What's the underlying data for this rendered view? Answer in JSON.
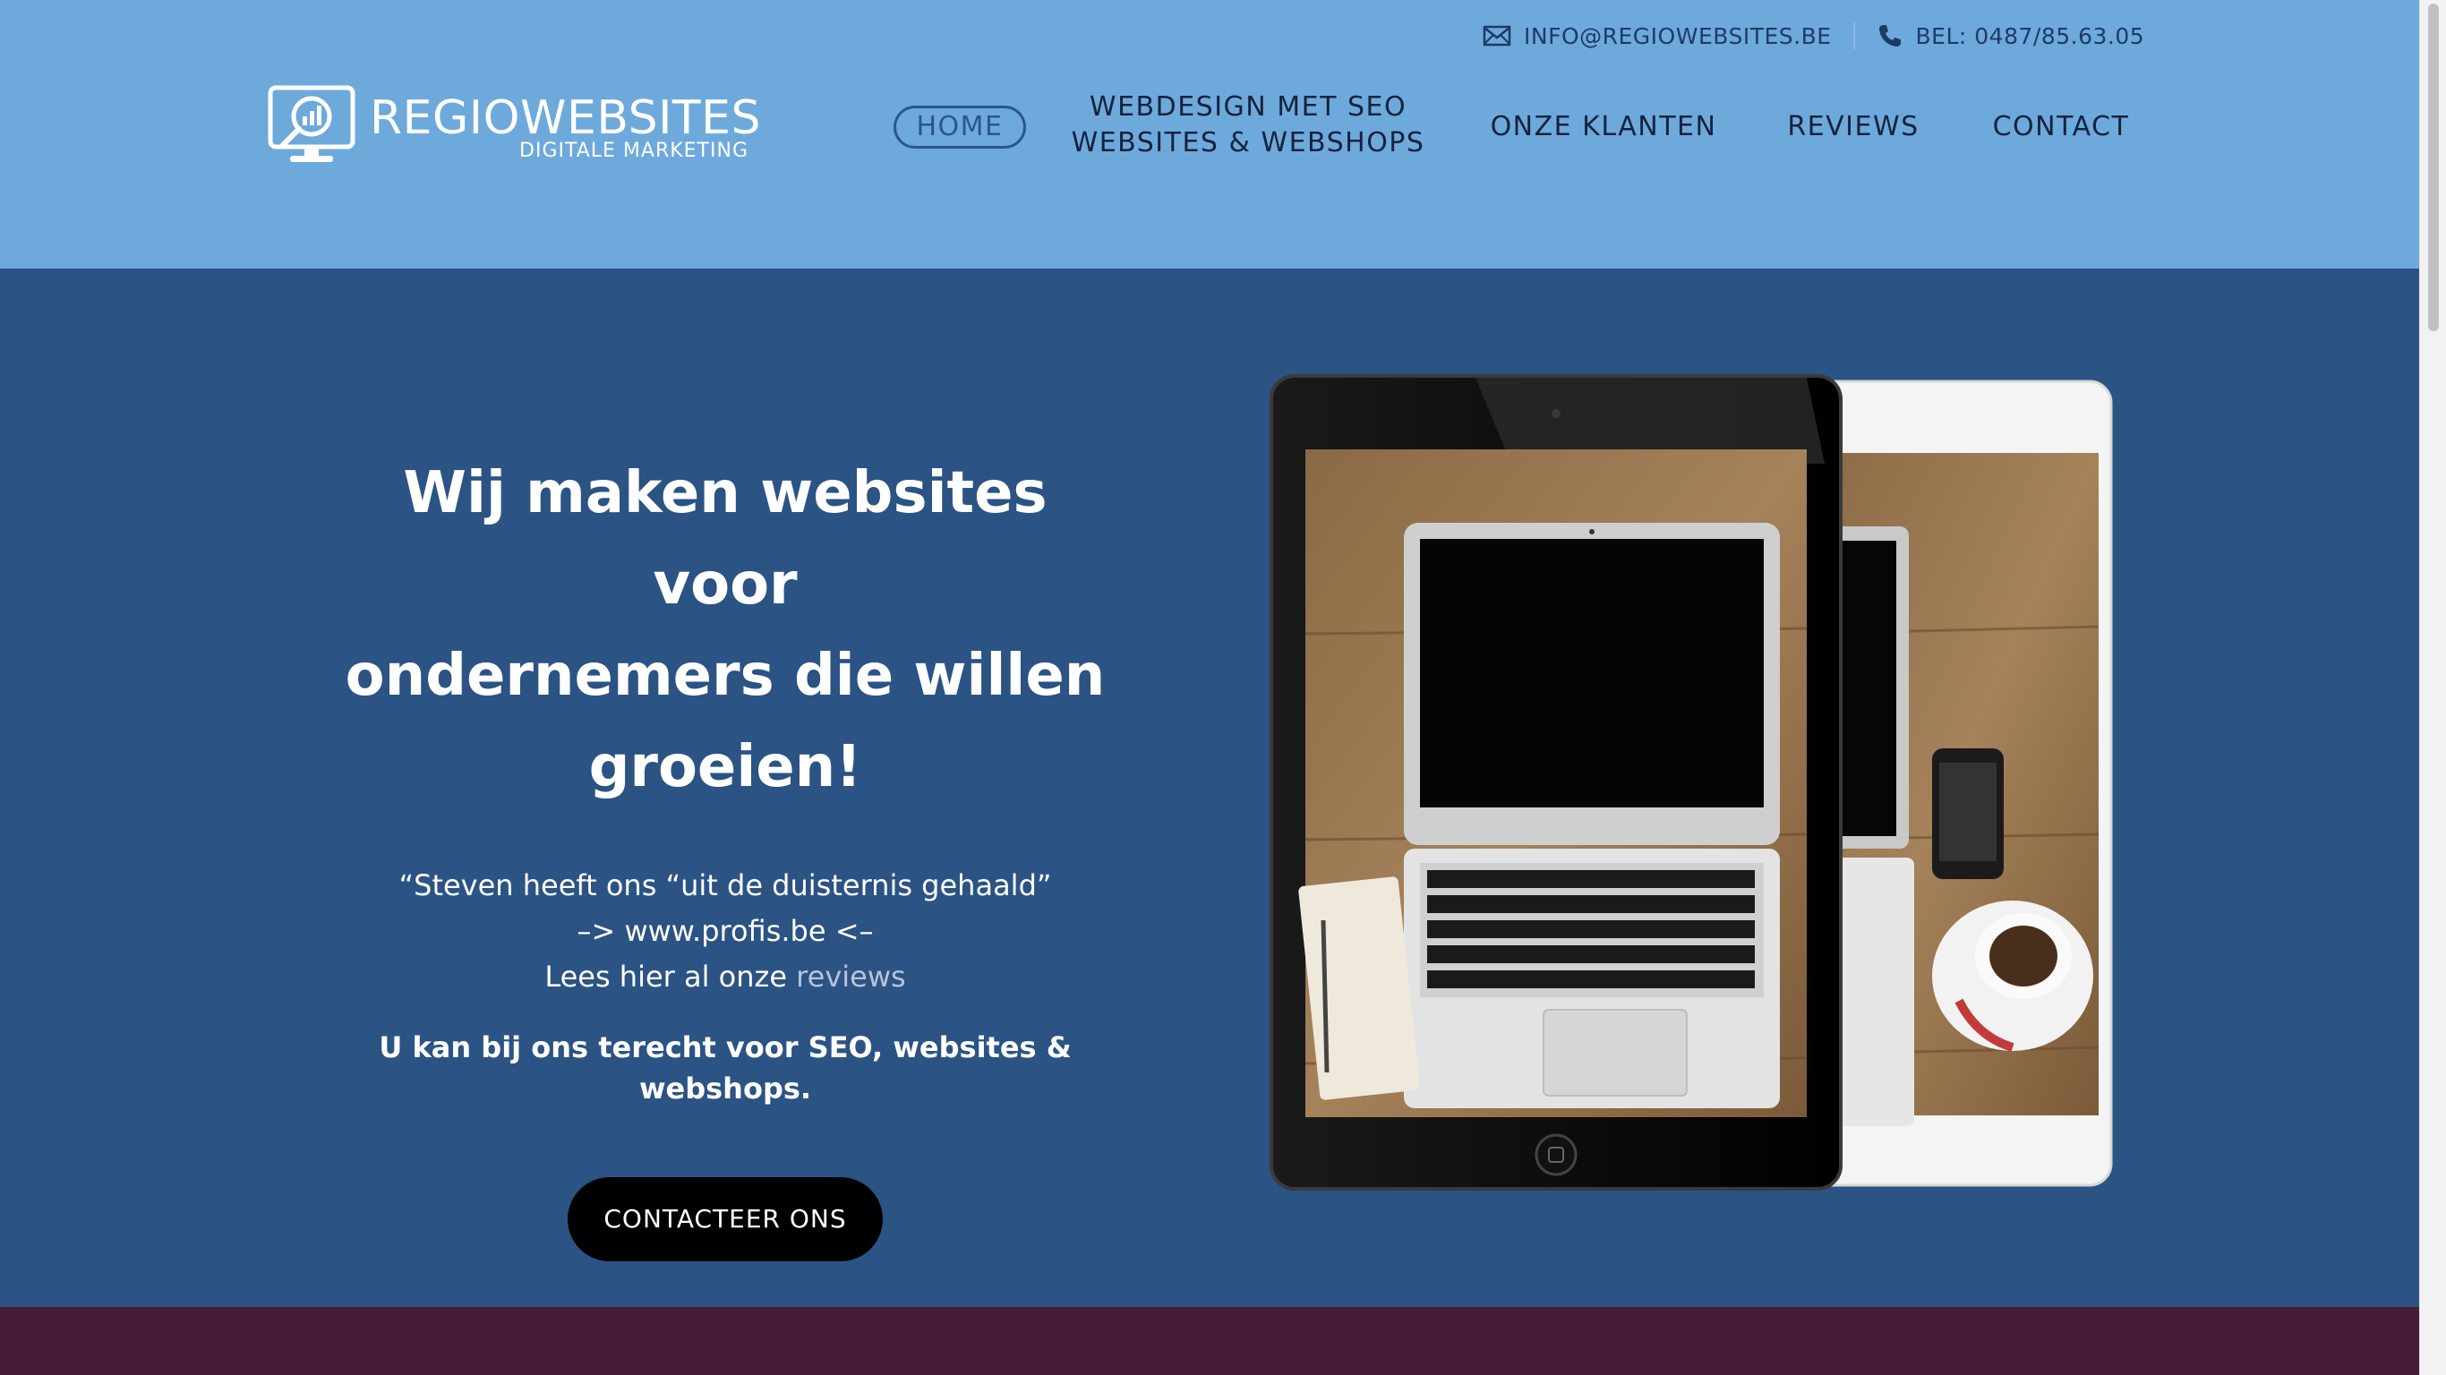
{
  "colors": {
    "header_bg": "#6ea9dc",
    "hero_bg": "#2b5384",
    "bottom_strip": "#441c35",
    "cta_bg": "#000000",
    "nav_active": "#2a568e"
  },
  "topbar": {
    "email": "INFO@REGIOWEBSITES.BE",
    "email_icon": "envelope-icon",
    "phone": "BEL: 0487/85.63.05",
    "phone_icon": "phone-icon"
  },
  "logo": {
    "title_bold": "REGIO",
    "title_light": "WEBSITES",
    "subtitle": "DIGITALE MARKETING",
    "icon": "monitor-chart-icon"
  },
  "nav": {
    "home": "HOME",
    "webdesign_line1": "WEBDESIGN MET SEO",
    "webdesign_line2": "WEBSITES & WEBSHOPS",
    "klanten": "ONZE KLANTEN",
    "reviews": "REVIEWS",
    "contact": "CONTACT"
  },
  "hero": {
    "title_line1": "Wij maken websites voor",
    "title_line2": "ondernemers die willen",
    "title_line3": "groeien!",
    "quote_line1": "“Steven heeft ons “uit de duisternis gehaald”",
    "quote_line2": "–> www.profis.be <–",
    "quote_line3_prefix": "Lees hier al onze ",
    "quote_line3_link": "reviews",
    "tagline": "U kan bij ons terecht voor SEO, websites & webshops.",
    "cta": "CONTACTEER ONS",
    "image": "tablets-laptop-image"
  }
}
